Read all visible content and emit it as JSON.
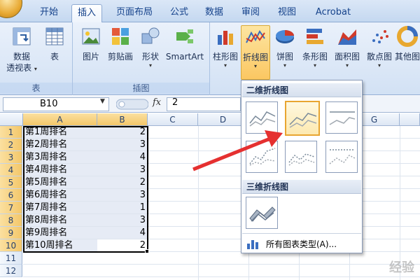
{
  "tabs": [
    {
      "label": "开始",
      "active": false
    },
    {
      "label": "插入",
      "active": true
    },
    {
      "label": "页面布局",
      "active": false
    },
    {
      "label": "公式",
      "active": false
    },
    {
      "label": "数据",
      "active": false
    },
    {
      "label": "审阅",
      "active": false
    },
    {
      "label": "视图",
      "active": false
    },
    {
      "label": "Acrobat",
      "active": false
    }
  ],
  "ribbon": {
    "groups": {
      "table": {
        "label": "表",
        "buttons": [
          "数据",
          "透视表",
          "表"
        ]
      },
      "illustrations": {
        "label": "插图",
        "buttons": [
          "图片",
          "剪贴画",
          "形状",
          "SmartArt"
        ]
      },
      "charts": {
        "buttons": [
          "柱形图",
          "折线图",
          "饼图",
          "条形图",
          "面积图",
          "散点图",
          "其他图表"
        ]
      }
    }
  },
  "formula_bar": {
    "name_box": "B10",
    "fx": "fx",
    "value": "2"
  },
  "columns": [
    "A",
    "B",
    "C",
    "D",
    "E",
    "F",
    "G"
  ],
  "rows": [
    {
      "num": "1",
      "a": "第1周排名",
      "b": "2"
    },
    {
      "num": "2",
      "a": "第2周排名",
      "b": "3"
    },
    {
      "num": "3",
      "a": "第3周排名",
      "b": "4"
    },
    {
      "num": "4",
      "a": "第4周排名",
      "b": "3"
    },
    {
      "num": "5",
      "a": "第5周排名",
      "b": "2"
    },
    {
      "num": "6",
      "a": "第6周排名",
      "b": "3"
    },
    {
      "num": "7",
      "a": "第7周排名",
      "b": "1"
    },
    {
      "num": "8",
      "a": "第8周排名",
      "b": "3"
    },
    {
      "num": "9",
      "a": "第9周排名",
      "b": "4"
    },
    {
      "num": "10",
      "a": "第10周排名",
      "b": "2"
    },
    {
      "num": "11",
      "a": "",
      "b": ""
    },
    {
      "num": "12",
      "a": "",
      "b": ""
    }
  ],
  "dropdown": {
    "section_2d": "二维折线图",
    "section_3d": "三维折线图",
    "footer": "所有图表类型(A)..."
  },
  "colors": {
    "accent": "#15428b",
    "highlight": "#fbc762",
    "arrow": "#e53030"
  },
  "watermark": "经验"
}
